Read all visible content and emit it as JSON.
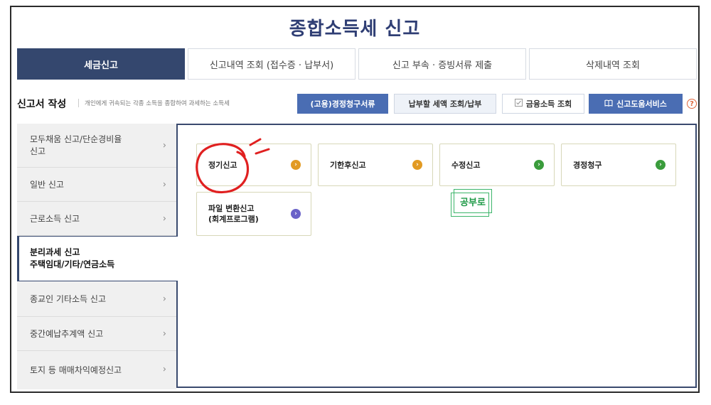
{
  "page": {
    "title": "종합소득세 신고"
  },
  "tabs": [
    {
      "label": "세금신고",
      "active": true
    },
    {
      "label": "신고내역 조회 (접수증 · 납부서)"
    },
    {
      "label": "신고 부속 · 증빙서류 제출"
    },
    {
      "label": "삭제내역 조회"
    }
  ],
  "toolbar": {
    "section_title": "신고서 작성",
    "section_desc": "개인에게 귀속되는 각종 소득을 종합하여 과세하는 소득세",
    "buttons": [
      {
        "label": "(고용)경정청구서류"
      },
      {
        "label": "납부할 세액 조회/납부"
      },
      {
        "label": "금융소득 조회",
        "icon": "checkbox-icon"
      },
      {
        "label": "신고도움서비스",
        "icon": "book-icon"
      }
    ],
    "help_icon": "?"
  },
  "sidebar": {
    "items": [
      {
        "lines": [
          "모두채움 신고/단순경비율",
          "신고"
        ]
      },
      {
        "lines": [
          "일반 신고"
        ]
      },
      {
        "lines": [
          "근로소득 신고"
        ]
      },
      {
        "lines": [
          "분리과세 신고",
          "주택임대/기타/연금소득"
        ],
        "active": true
      },
      {
        "lines": [
          "종교인 기타소득 신고"
        ]
      },
      {
        "lines": [
          "중간예납추계액 신고"
        ]
      },
      {
        "lines": [
          "토지 등 매매차익예정신고"
        ]
      }
    ]
  },
  "cards": [
    {
      "label": "정기신고",
      "color": "#e29a23"
    },
    {
      "label": "기한후신고",
      "color": "#e29a23"
    },
    {
      "label": "수정신고",
      "color": "#3a9c3c"
    },
    {
      "label": "경정청구",
      "color": "#3a9c3c"
    },
    {
      "lines": [
        "파일 변환신고",
        "(회계프로그램)"
      ],
      "color": "#6a62c8"
    }
  ],
  "stamp": {
    "text": "공부로"
  },
  "colors": {
    "primary": "#34476e",
    "accent_blue": "#4a6db3",
    "annotation_red": "#e02020"
  }
}
